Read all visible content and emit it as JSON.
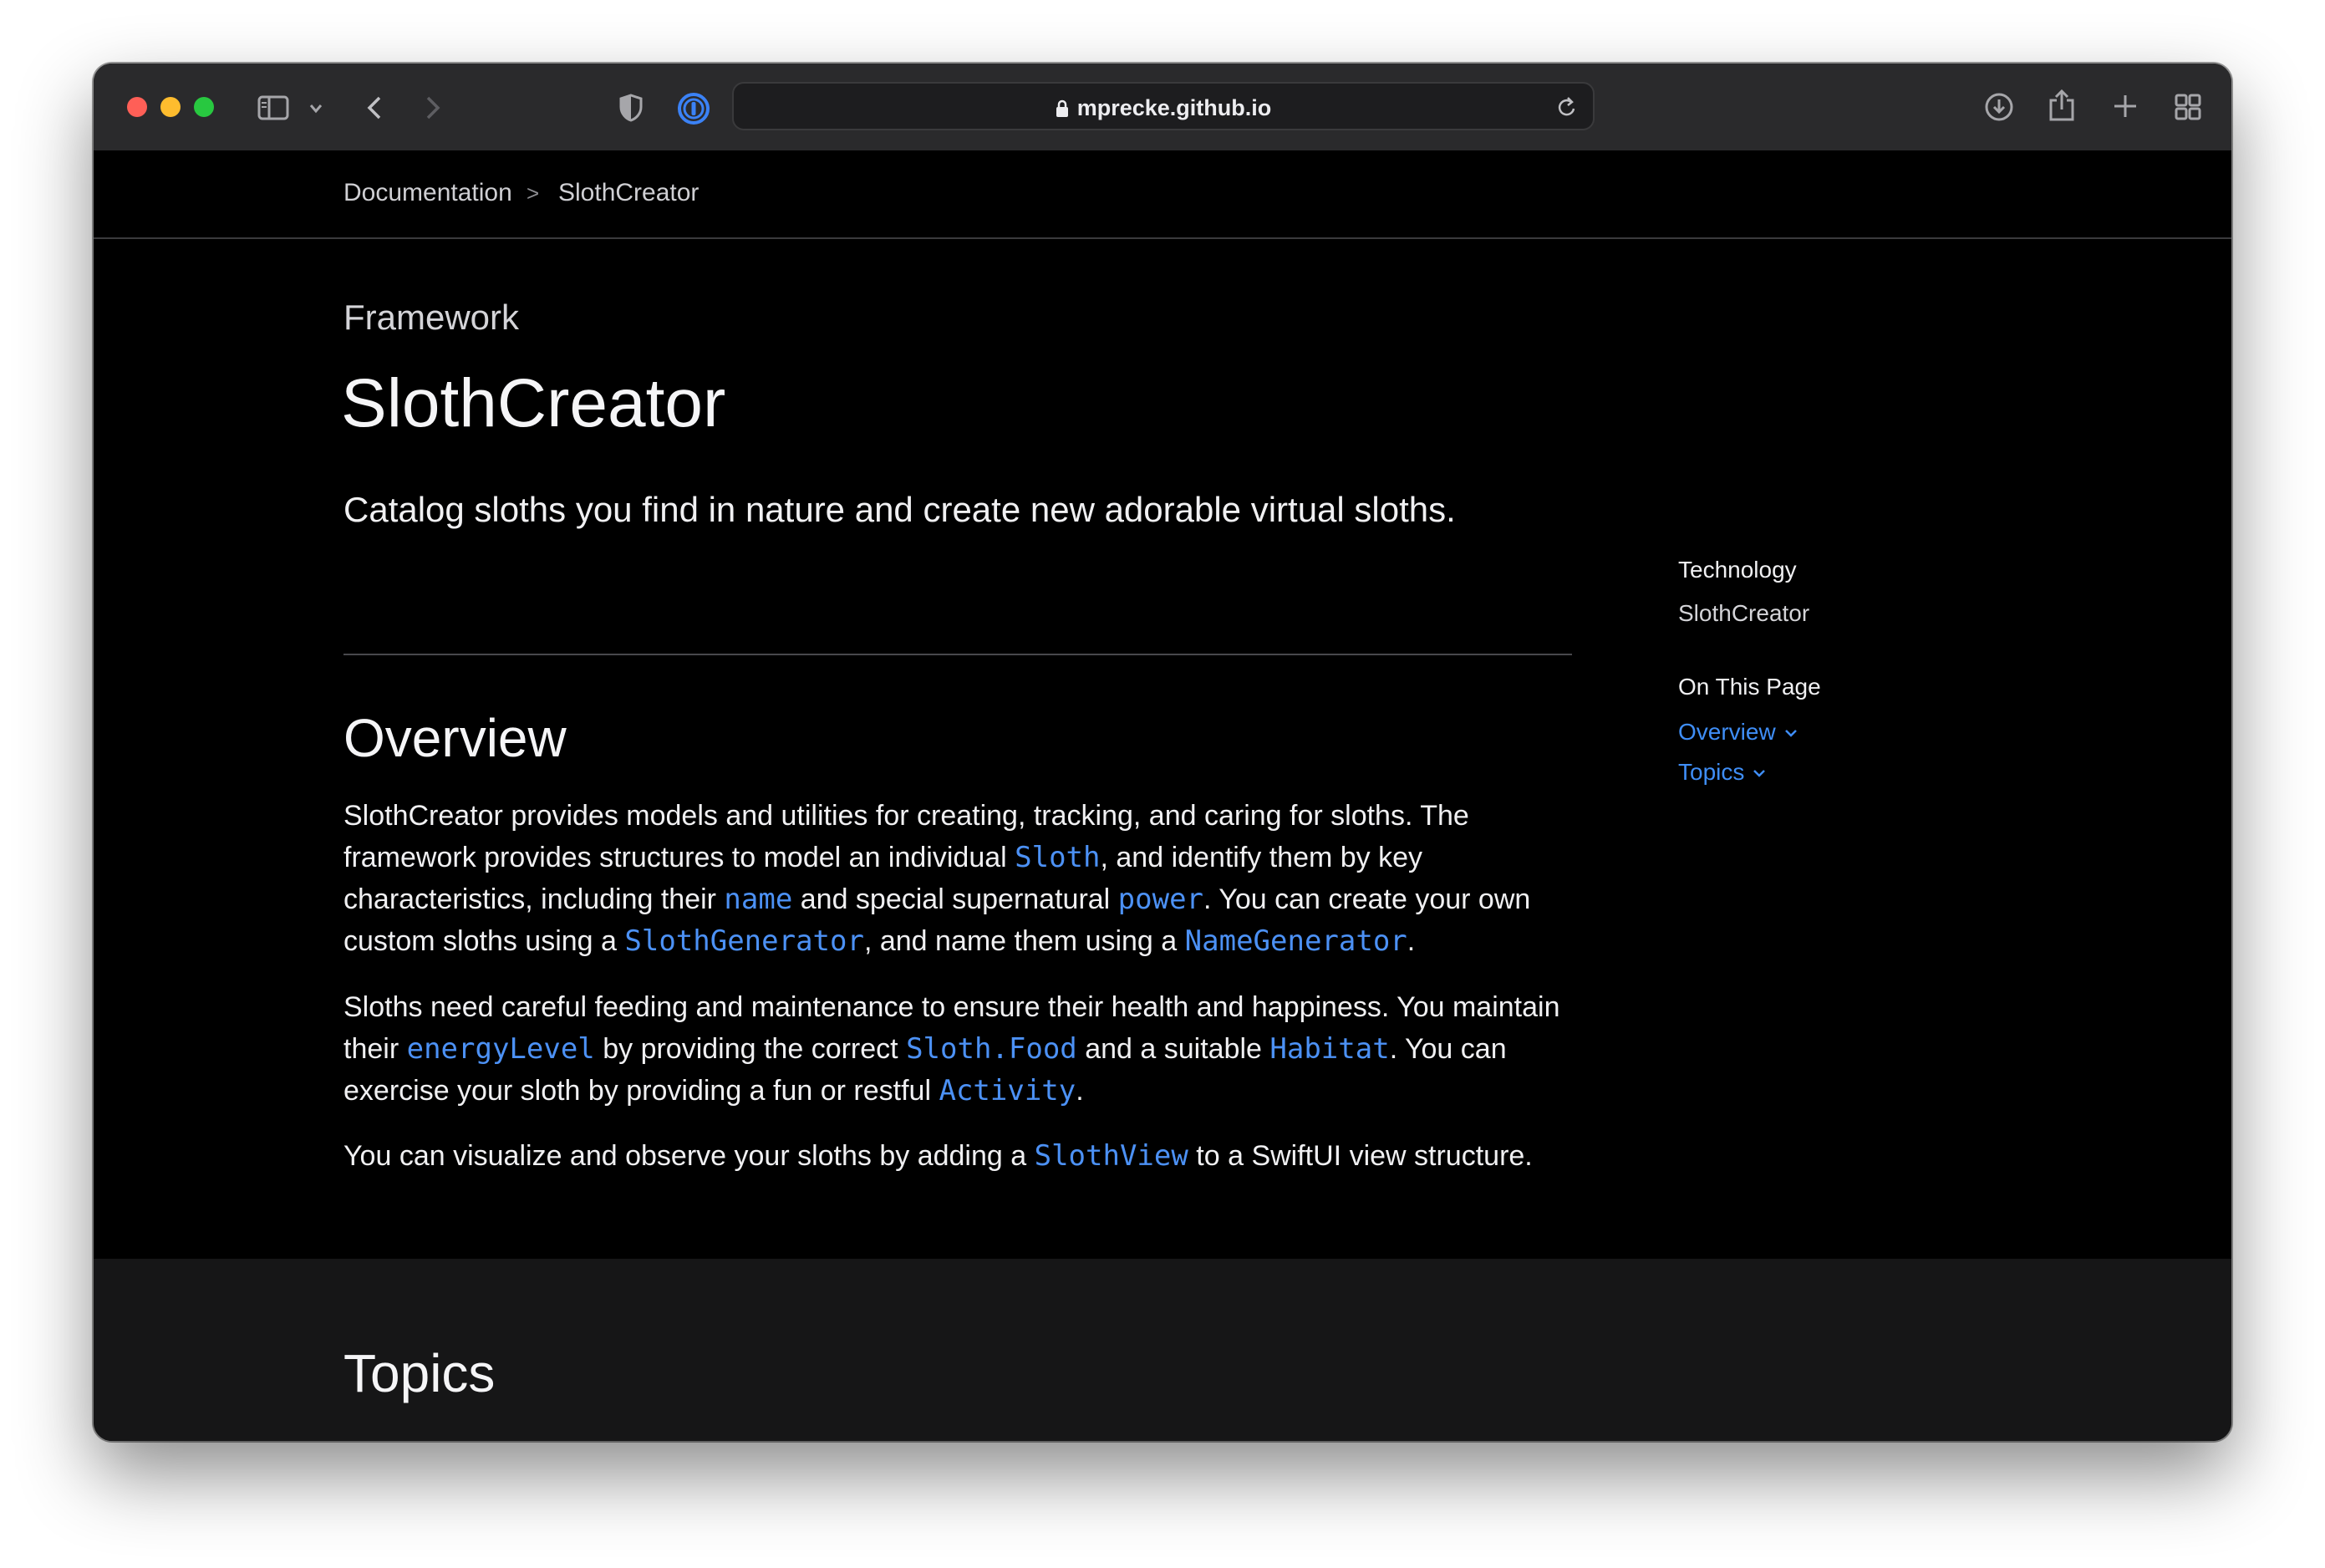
{
  "browser": {
    "url": "mprecke.github.io"
  },
  "breadcrumb": {
    "items": [
      "Documentation",
      "SlothCreator"
    ],
    "separator": ">"
  },
  "page": {
    "eyebrow": "Framework",
    "title": "SlothCreator",
    "abstract": "Catalog sloths you find in nature and create new adorable virtual sloths.",
    "overview_heading": "Overview",
    "p1": {
      "t1": "SlothCreator provides models and utilities for creating, tracking, and caring for sloths. The framework provides structures to model an individual ",
      "c1": "Sloth",
      "t2": ", and identify them by key characteristics, including their ",
      "c2": "name",
      "t3": " and special supernatural ",
      "c3": "power",
      "t4": ". You can create your own custom sloths using a ",
      "c4": "SlothGenerator",
      "t5": ", and name them using a ",
      "c5": "NameGenerator",
      "t6": "."
    },
    "p2": {
      "t1": "Sloths need careful feeding and maintenance to ensure their health and happiness. You maintain their ",
      "c1": "energyLevel",
      "t2": " by providing the correct ",
      "c2": "Sloth.Food",
      "t3": " and a suitable ",
      "c3": "Habitat",
      "t4": ". You can exercise your sloth by providing a fun or restful ",
      "c4": "Activity",
      "t5": "."
    },
    "p3": {
      "t1": "You can visualize and observe your sloths by adding a ",
      "c1": "SlothView",
      "t2": " to a SwiftUI view structure."
    },
    "topics_heading": "Topics"
  },
  "sidebar": {
    "technology_label": "Technology",
    "technology_value": "SlothCreator",
    "on_this_page_label": "On This Page",
    "links": [
      "Overview",
      "Topics"
    ]
  },
  "colors": {
    "accent": "#4c91f5",
    "background": "#000000",
    "topics_background": "#161617"
  },
  "icons": [
    "sidebar-icon",
    "chevron-down-icon",
    "back-icon",
    "forward-icon",
    "shield-icon",
    "password-manager-icon",
    "lock-icon",
    "reload-icon",
    "download-icon",
    "share-icon",
    "new-tab-icon",
    "tab-overview-icon"
  ]
}
